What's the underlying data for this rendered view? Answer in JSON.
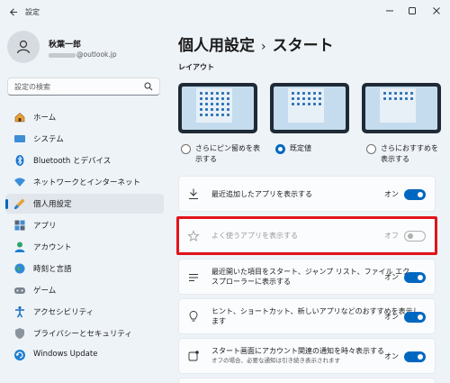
{
  "window": {
    "title": "設定"
  },
  "user": {
    "name": "秋葉一郎",
    "email_suffix": "@outlook.jp"
  },
  "search": {
    "placeholder": "設定の検索"
  },
  "sidebar": {
    "items": [
      {
        "label": "ホーム",
        "icon": "home-icon"
      },
      {
        "label": "システム",
        "icon": "monitor-icon"
      },
      {
        "label": "Bluetooth とデバイス",
        "icon": "bluetooth-icon"
      },
      {
        "label": "ネットワークとインターネット",
        "icon": "wifi-icon"
      },
      {
        "label": "個人用設定",
        "icon": "brush-icon",
        "active": true
      },
      {
        "label": "アプリ",
        "icon": "apps-icon"
      },
      {
        "label": "アカウント",
        "icon": "person-icon"
      },
      {
        "label": "時刻と言語",
        "icon": "globe-icon"
      },
      {
        "label": "ゲーム",
        "icon": "gamepad-icon"
      },
      {
        "label": "アクセシビリティ",
        "icon": "accessibility-icon"
      },
      {
        "label": "プライバシーとセキュリティ",
        "icon": "shield-icon"
      },
      {
        "label": "Windows Update",
        "icon": "update-icon"
      }
    ]
  },
  "header": {
    "parent": "個人用設定",
    "separator": "›",
    "current": "スタート"
  },
  "layout": {
    "section_label": "レイアウト",
    "options": [
      {
        "label_line1": "さらにピン留めを表",
        "label_line2": "示する",
        "selected": false
      },
      {
        "label_line1": "既定値",
        "label_line2": "",
        "selected": true
      },
      {
        "label_line1": "さらにおすすめを",
        "label_line2": "表示する",
        "selected": false
      }
    ]
  },
  "settings": [
    {
      "label": "最近追加したアプリを表示する",
      "state": "オン",
      "on": true
    },
    {
      "label": "よく使うアプリを表示する",
      "state": "オフ",
      "on": false,
      "disabled": true
    },
    {
      "label_line1": "最近開いた項目をスタート、ジャンプ リスト、ファイル エク",
      "label_line2": "スプローラーに表示する",
      "state": "オン",
      "on": true
    },
    {
      "label_line1": "ヒント、ショートカット、新しいアプリなどのおすすめを表示し",
      "label_line2": "ます",
      "state": "オン",
      "on": true
    },
    {
      "label": "スタート画面にアカウント関連の通知を時々表示する",
      "sublabel": "オフの場合、必要な通知は引き続き表示されます",
      "state": "オン",
      "on": true
    }
  ],
  "colors": {
    "accent": "#0067c0",
    "highlight": "#e2141a"
  }
}
